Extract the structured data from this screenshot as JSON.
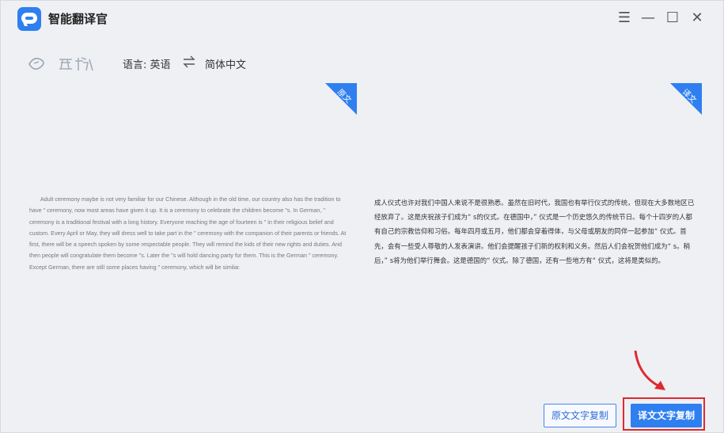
{
  "app": {
    "title": "智能翻译官",
    "accent_color": "#2f7ff0",
    "highlight_color": "#e0282e"
  },
  "window_controls": [
    {
      "name": "menu-icon",
      "glyph": "☰"
    },
    {
      "name": "minimize-icon",
      "glyph": "—"
    },
    {
      "name": "maximize-icon",
      "glyph": "☐"
    },
    {
      "name": "close-icon",
      "glyph": "✕"
    }
  ],
  "toolbar": {
    "language_label": "语言: 英语",
    "target_language": "简体中文"
  },
  "source_pane": {
    "tag": "原文",
    "text": "Adult ceremony maybe is not very familiar for our Chinese. Although in the old time, our country also has the tradition to have \" ceremony, now most areas have given it up. It is a ceremony to celebrate the children become \"s. In German, \" ceremony is a traditional festival with a long history. Everyone reaching the age of fourteen is \" in their religious belief and custom. Every April or May, they will dress well to take part in the \" ceremony with the companion of their parents or friends. At first, there will be a speech spoken by some respectable people. They will remind the kids of their new rights and duties. And then people will congratulate them become \"s. Later the \"s will hold dancing party for them. This is the German \" ceremony. Except German, there are still some places having \" ceremony, which will be similar."
  },
  "target_pane": {
    "tag": "译文",
    "text": "成人仪式也许对我们中国人来说不是很熟悉。虽然在旧时代，我国也有举行仪式的传统，但现在大多数地区已经放弃了。这是庆祝孩子们成为“ s的仪式。在德国中，” 仪式是一个历史悠久的传统节日。每个十四岁的人都有自己的宗教信仰和习俗。每年四月或五月，他们都会穿着得体，与父母或朋友的同伴一起参加“ 仪式。首先，会有一些受人尊敬的人发表演讲。他们会提醒孩子们新的权利和义务。然后人们会祝贺他们成为“ s。稍后，” s将为他们举行舞会。这是德国的“ 仪式。除了德国，还有一些地方有“ 仪式，这将是类似的。"
  },
  "buttons": {
    "copy_source": "原文文字复制",
    "copy_target": "译文文字复制"
  }
}
